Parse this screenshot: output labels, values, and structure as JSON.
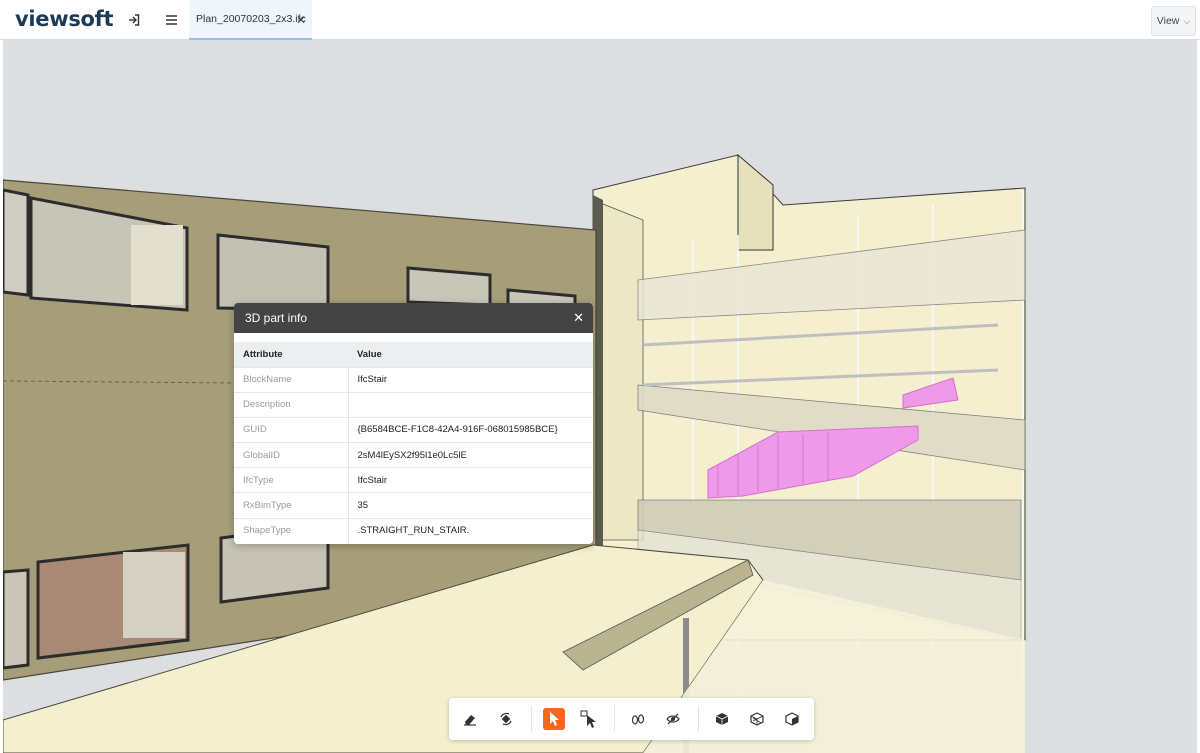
{
  "app": {
    "logo": "viewsoft"
  },
  "header": {
    "login_icon": "login-icon",
    "menu_icon": "hamburger-menu-icon",
    "tab": {
      "label": "Plan_20070203_2x3.ifc",
      "close": "✕"
    },
    "view_button": {
      "label": "View",
      "chevron": "⌵"
    }
  },
  "panel": {
    "title": "3D part info",
    "close": "✕",
    "columns": [
      "Attribute",
      "Value"
    ],
    "rows": [
      {
        "attribute": "BlockName",
        "value": "IfcStair"
      },
      {
        "attribute": "Description",
        "value": ""
      },
      {
        "attribute": "GUID",
        "value": "{B6584BCE-F1C8-42A4-916F-068015985BCE}"
      },
      {
        "attribute": "GlobalID",
        "value": "2sM4lEySX2f95l1e0Lc5lE"
      },
      {
        "attribute": "IfcType",
        "value": "IfcStair"
      },
      {
        "attribute": "RxBimType",
        "value": "35"
      },
      {
        "attribute": "ShapeType",
        "value": ".STRAIGHT_RUN_STAIR."
      }
    ]
  },
  "toolbar": {
    "tools": [
      "eraser-icon",
      "rotate-icon",
      "select-cursor-icon",
      "box-select-cursor-icon",
      "show-icon",
      "hide-icon",
      "solid-cube-icon",
      "xray-cube-icon",
      "section-cube-icon"
    ],
    "active_tool": "select-cursor-icon",
    "accent_color": "#f46a1c"
  },
  "colors": {
    "facade": "#a69e79",
    "interior": "#f5f1d2",
    "selected_stair": "#ef9ae8",
    "sky": "#dcdee2",
    "panel_header": "#444444"
  }
}
